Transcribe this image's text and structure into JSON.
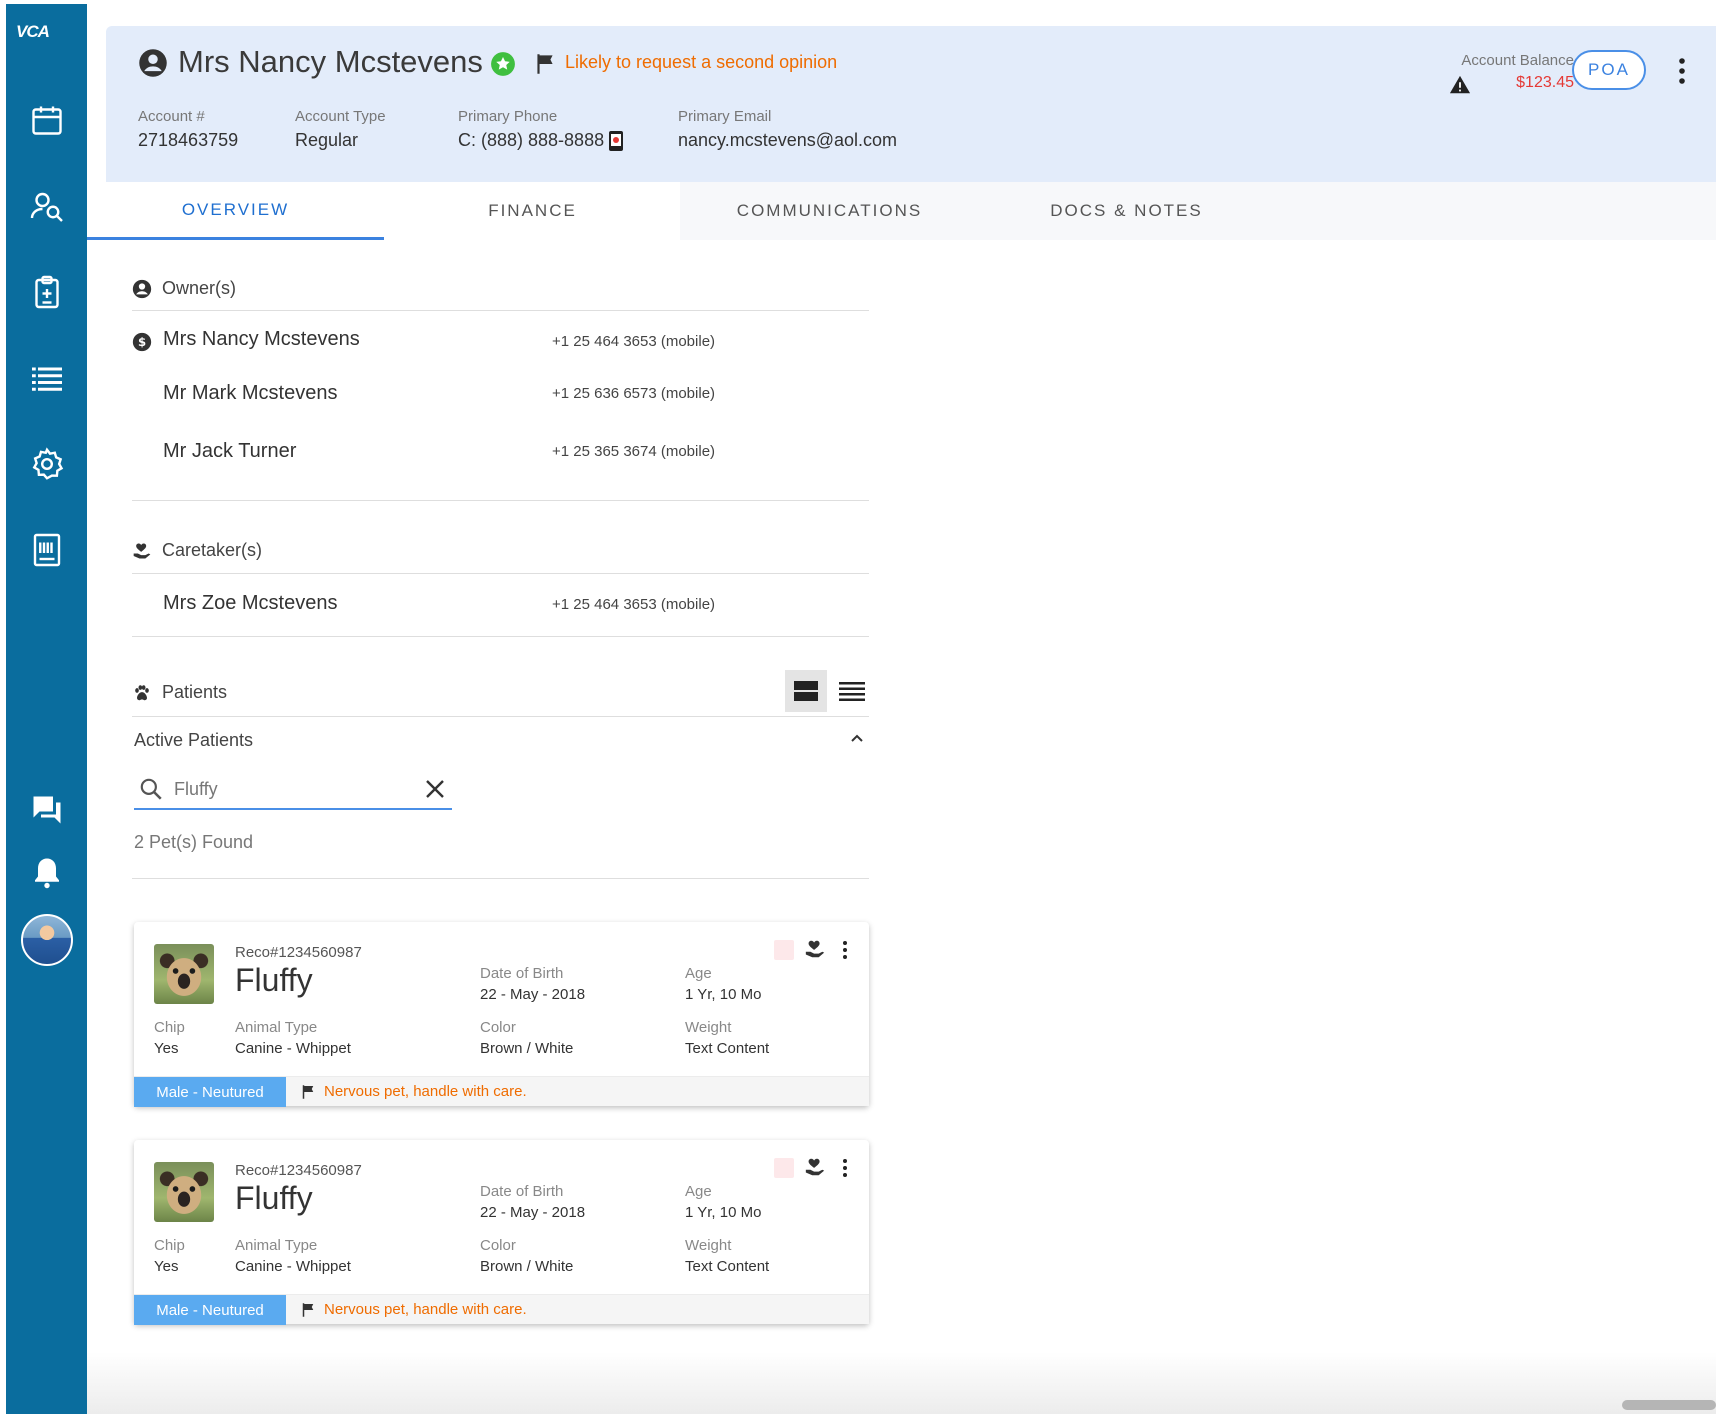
{
  "brand": {
    "logo_text": "VCA"
  },
  "sidebar": {
    "items": [
      {
        "name": "calendar-icon"
      },
      {
        "name": "user-search-icon"
      },
      {
        "name": "clipboard-icon"
      },
      {
        "name": "list-icon"
      },
      {
        "name": "settings-icon"
      },
      {
        "name": "barcode-icon"
      },
      {
        "name": "chat-icon"
      },
      {
        "name": "bell-icon"
      }
    ],
    "accent": "#0a6d9e"
  },
  "header": {
    "owner_name": "Mrs Nancy Mcstevens",
    "flag_text": "Likely to request a second opinion",
    "fields": [
      {
        "label": "Account #",
        "value": "2718463759"
      },
      {
        "label": "Account Type",
        "value": "Regular"
      },
      {
        "label": "Primary Phone",
        "value": "C: (888) 888-8888"
      },
      {
        "label": "Primary Email",
        "value": "nancy.mcstevens@aol.com"
      }
    ],
    "balance_label": "Account Balance",
    "balance_value": "$123.45",
    "poa_label": "POA",
    "background": "#e3ecfa"
  },
  "tabs": [
    {
      "label": "OVERVIEW",
      "active": true
    },
    {
      "label": "FINANCE",
      "active": false
    },
    {
      "label": "COMMUNICATIONS",
      "active": false
    },
    {
      "label": "DOCS & NOTES",
      "active": false
    }
  ],
  "owners": {
    "heading": "Owner(s)",
    "people": [
      {
        "name": "Mrs Nancy Mcstevens",
        "phone": "+1 25 464 3653 (mobile)",
        "primary": true
      },
      {
        "name": "Mr Mark Mcstevens",
        "phone": "+1 25 636 6573 (mobile)",
        "primary": false
      },
      {
        "name": "Mr Jack Turner",
        "phone": "+1 25 365 3674 (mobile)",
        "primary": false
      }
    ]
  },
  "caretakers": {
    "heading": "Caretaker(s)",
    "people": [
      {
        "name": "Mrs Zoe Mcstevens",
        "phone": "+1 25 464 3653 (mobile)"
      }
    ]
  },
  "patients": {
    "heading": "Patients",
    "subheading": "Active Patients",
    "search_value": "Fluffy",
    "found_text": "2 Pet(s) Found",
    "cards": [
      {
        "record": "Reco#1234560987",
        "name": "Fluffy",
        "dob_label": "Date of Birth",
        "dob": "22 - May - 2018",
        "age_label": "Age",
        "age": "1 Yr, 10 Mo",
        "chip_label": "Chip",
        "chip": "Yes",
        "type_label": "Animal Type",
        "type": "Canine - Whippet",
        "color_label": "Color",
        "color": "Brown / White",
        "weight_label": "Weight",
        "weight": "Text Content",
        "sex": "Male - Neutured",
        "note": "Nervous pet, handle with care."
      },
      {
        "record": "Reco#1234560987",
        "name": "Fluffy",
        "dob_label": "Date of Birth",
        "dob": "22 - May - 2018",
        "age_label": "Age",
        "age": "1 Yr, 10 Mo",
        "chip_label": "Chip",
        "chip": "Yes",
        "type_label": "Animal Type",
        "type": "Canine - Whippet",
        "color_label": "Color",
        "color": "Brown / White",
        "weight_label": "Weight",
        "weight": "Text Content",
        "sex": "Male - Neutured",
        "note": "Nervous pet, handle with care."
      }
    ]
  }
}
